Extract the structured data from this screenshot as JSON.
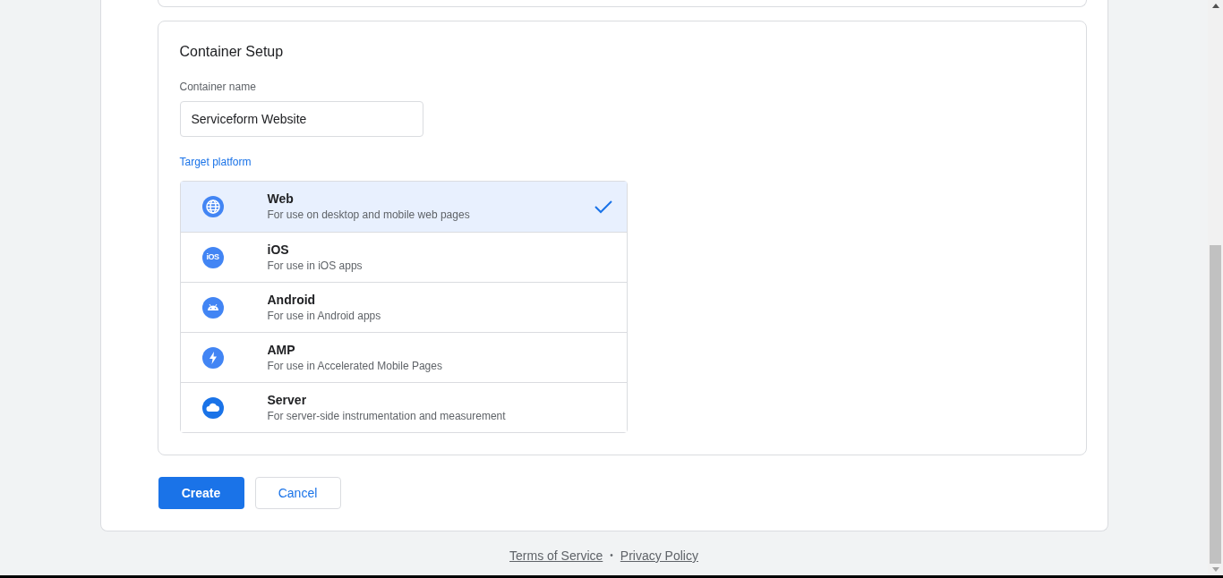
{
  "setup": {
    "title": "Container Setup",
    "name_field": {
      "label": "Container name",
      "value": "Serviceform Website"
    },
    "platform_label": "Target platform",
    "platforms": [
      {
        "kind": "web",
        "title": "Web",
        "description": "For use on desktop and mobile web pages",
        "selected": true
      },
      {
        "kind": "ios",
        "icon_label": "iOS",
        "title": "iOS",
        "description": "For use in iOS apps",
        "selected": false
      },
      {
        "kind": "android",
        "title": "Android",
        "description": "For use in Android apps",
        "selected": false
      },
      {
        "kind": "amp",
        "title": "AMP",
        "description": "For use in Accelerated Mobile Pages",
        "selected": false
      },
      {
        "kind": "server",
        "title": "Server",
        "description": "For server-side instrumentation and measurement",
        "selected": false
      }
    ]
  },
  "actions": {
    "primary": "Create",
    "secondary": "Cancel"
  },
  "footer": {
    "links": [
      "Terms of Service",
      "Privacy Policy"
    ],
    "separator": "•"
  }
}
